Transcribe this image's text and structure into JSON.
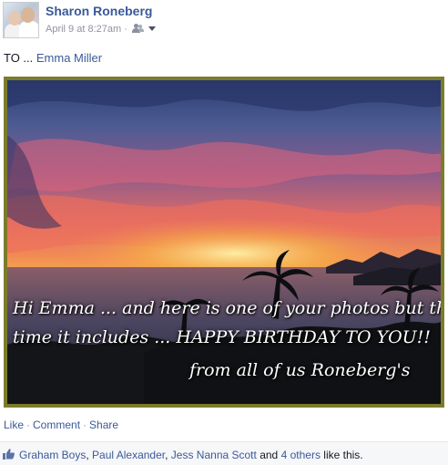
{
  "post": {
    "author": "Sharon Roneberg",
    "timestamp": "April 9 at 8:27am",
    "meta_separator": "·",
    "audience_icon": "friends-icon",
    "audience_menu_icon": "caret-down-icon",
    "text_prefix": "TO ... ",
    "tagged_name": "Emma Miller"
  },
  "photo": {
    "caption_line1": "Hi Emma ... and here is one of your photos but this",
    "caption_line2": "time it includes ... HAPPY BIRTHDAY TO YOU!!",
    "caption_line3": "from all of us Roneberg's",
    "frame_color": "#7b7c2a"
  },
  "actions": {
    "like": "Like",
    "comment": "Comment",
    "share": "Share",
    "separator": "·"
  },
  "likes": {
    "icon": "thumbs-up-icon",
    "names": [
      "Graham Boys",
      "Paul Alexander",
      "Jess Nanna Scott"
    ],
    "comma": ",",
    "and": "and",
    "others": "4 others",
    "suffix": "like this."
  },
  "colors": {
    "link": "#3b5998",
    "meta": "#90949c"
  }
}
